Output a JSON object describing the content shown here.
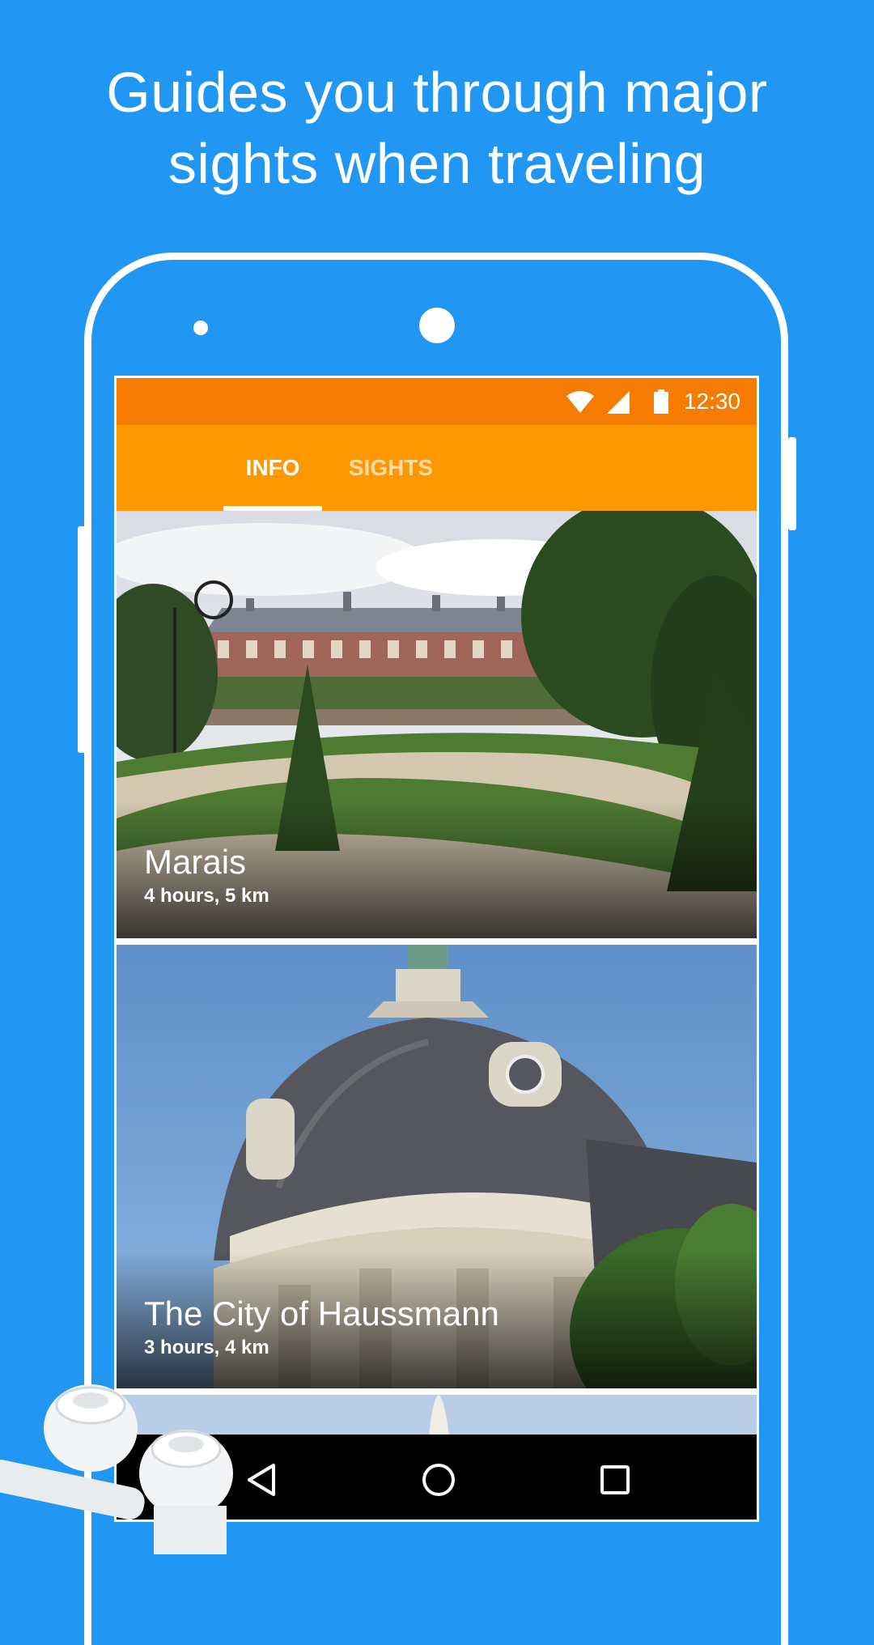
{
  "headline": {
    "line1": "Guides you through major",
    "line2": "sights when traveling"
  },
  "status_bar": {
    "time": "12:30",
    "icons": [
      "wifi-icon",
      "signal-icon",
      "battery-icon"
    ]
  },
  "tabs": [
    {
      "label": "INFO",
      "active": true
    },
    {
      "label": "SIGHTS",
      "active": false
    }
  ],
  "cards": [
    {
      "title": "Marais",
      "subtitle": "4 hours, 5 km"
    },
    {
      "title": "The City of Haussmann",
      "subtitle": "3 hours, 4 km"
    }
  ],
  "nav_bar": {
    "icons": [
      "back-icon",
      "home-icon",
      "recents-icon"
    ]
  },
  "colors": {
    "background": "#2196F3",
    "status_bar": "#F57C00",
    "tab_bar": "#FF9800",
    "nav_bar": "#000000"
  }
}
